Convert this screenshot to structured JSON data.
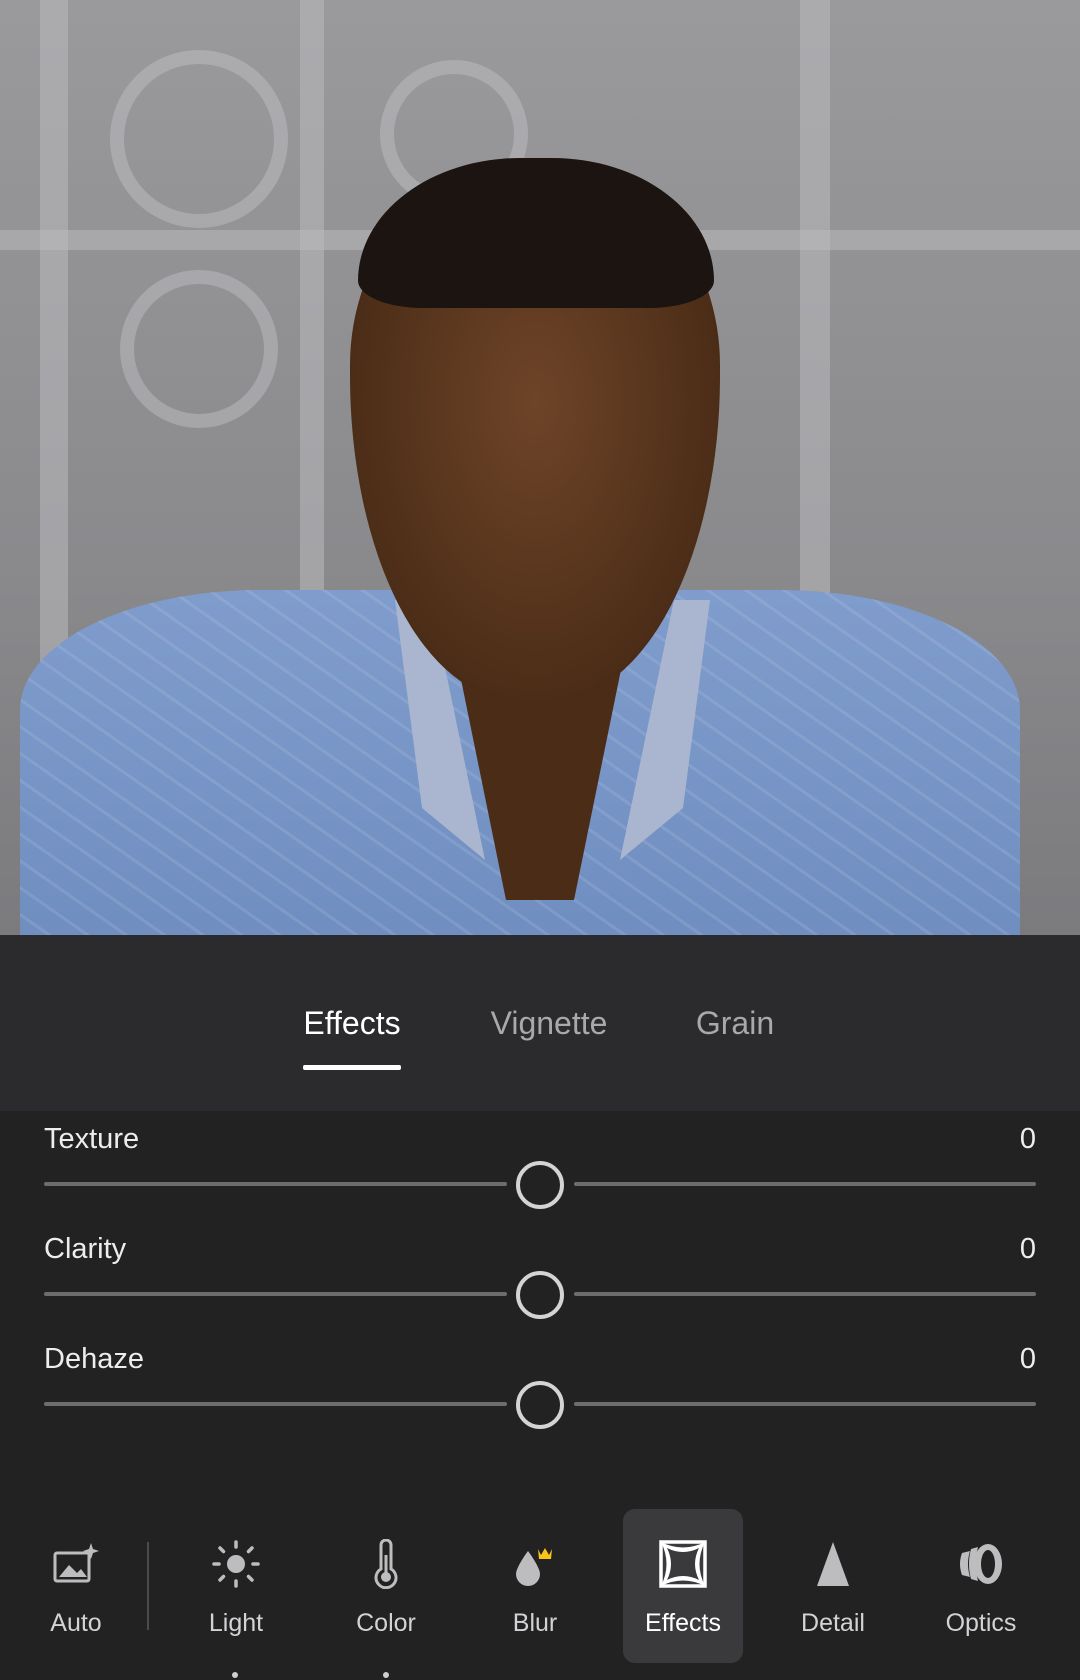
{
  "photo": {
    "alt_icon": "portrait-photo"
  },
  "subtabs": [
    {
      "label": "Effects",
      "active": true
    },
    {
      "label": "Vignette",
      "active": false
    },
    {
      "label": "Grain",
      "active": false
    }
  ],
  "sliders": [
    {
      "label": "Texture",
      "value": "0"
    },
    {
      "label": "Clarity",
      "value": "0"
    },
    {
      "label": "Dehaze",
      "value": "0"
    }
  ],
  "toolbar": {
    "items": [
      {
        "label": "Auto",
        "icon": "auto-magic-icon"
      },
      {
        "label": "Light",
        "icon": "sun-icon"
      },
      {
        "label": "Color",
        "icon": "thermometer-icon"
      },
      {
        "label": "Blur",
        "icon": "blur-drop-premium-icon"
      },
      {
        "label": "Effects",
        "icon": "effects-frame-icon",
        "active": true
      },
      {
        "label": "Detail",
        "icon": "triangle-icon"
      },
      {
        "label": "Optics",
        "icon": "lens-icon"
      }
    ]
  },
  "colors": {
    "background": "#222223",
    "accent": "#ffffff",
    "premium_crown": "#f5c518"
  }
}
